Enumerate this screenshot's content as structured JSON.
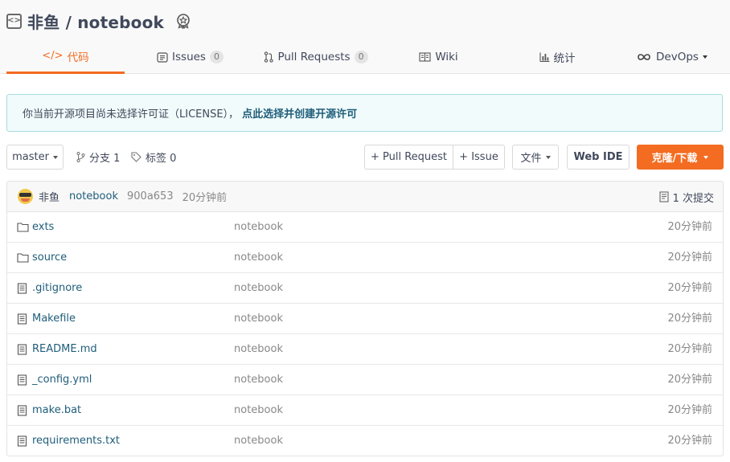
{
  "repo": {
    "title": "非鱼 / notebook"
  },
  "tabs": [
    {
      "label": "代码",
      "icon": "code-icon",
      "active": true
    },
    {
      "label": "Issues",
      "icon": "issues-icon",
      "count": "0"
    },
    {
      "label": "Pull Requests",
      "icon": "pull-request-icon",
      "count": "0"
    },
    {
      "label": "Wiki",
      "icon": "wiki-book-icon"
    },
    {
      "label": "统计",
      "icon": "bar-chart-icon"
    },
    {
      "label": "DevOps",
      "icon": "infinity-icon",
      "dropdown": true
    }
  ],
  "license": {
    "text": "你当前开源项目尚未选择许可证（LICENSE），",
    "link": "点此选择并创建开源许可"
  },
  "toolbar": {
    "branch": "master",
    "branches_label": "分支 1",
    "tags_label": "标签 0",
    "pull_request_label": "+ Pull Request",
    "issue_label": "+ Issue",
    "files_label": "文件",
    "web_ide_label": "Web IDE",
    "clone_label": "克隆/下载"
  },
  "commit": {
    "author": "非鱼",
    "message": "notebook",
    "sha": "900a653",
    "time": "20分钟前",
    "count_label": "1 次提交"
  },
  "files": [
    {
      "name": "exts",
      "type": "folder",
      "message": "notebook",
      "time": "20分钟前"
    },
    {
      "name": "source",
      "type": "folder",
      "message": "notebook",
      "time": "20分钟前"
    },
    {
      "name": ".gitignore",
      "type": "file",
      "message": "notebook",
      "time": "20分钟前"
    },
    {
      "name": "Makefile",
      "type": "file",
      "message": "notebook",
      "time": "20分钟前"
    },
    {
      "name": "README.md",
      "type": "file",
      "message": "notebook",
      "time": "20分钟前"
    },
    {
      "name": "_config.yml",
      "type": "file",
      "message": "notebook",
      "time": "20分钟前"
    },
    {
      "name": "make.bat",
      "type": "file",
      "message": "notebook",
      "time": "20分钟前"
    },
    {
      "name": "requirements.txt",
      "type": "file",
      "message": "notebook",
      "time": "20分钟前"
    }
  ],
  "colors": {
    "accent": "#f36c21",
    "link": "#1f5d7a",
    "notice_bg": "#f1fbfb",
    "notice_border": "#a8dcdf"
  }
}
